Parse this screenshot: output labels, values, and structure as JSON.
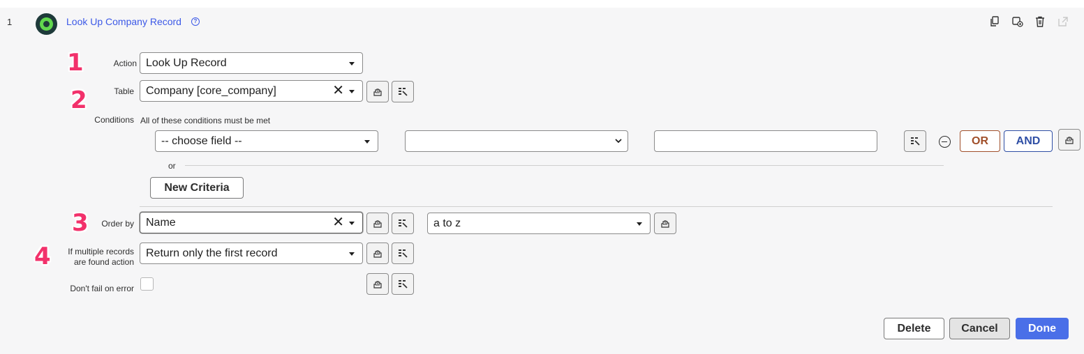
{
  "step": {
    "number": "1",
    "title": "Look Up Company Record",
    "help_icon": "question-circle-icon",
    "toolbar_icons": [
      "copy-icon",
      "data-pill-icon",
      "trash-icon",
      "external-link-icon"
    ]
  },
  "annotations": [
    "1",
    "2",
    "3",
    "4"
  ],
  "form": {
    "action": {
      "label": "Action",
      "value": "Look Up Record"
    },
    "table": {
      "label": "Table",
      "value": "Company [core_company]"
    },
    "conditions": {
      "label": "Conditions",
      "description": "All of these conditions must be met",
      "field_placeholder": "-- choose field --",
      "operator_value": "",
      "value": "",
      "or_label": "OR",
      "and_label": "AND",
      "or_separator": "or",
      "new_criteria_label": "New Criteria"
    },
    "order_by": {
      "label": "Order by",
      "value": "Name",
      "direction": "a to z"
    },
    "multiple_records": {
      "label_line1": "If multiple records",
      "label_line2": "are found action",
      "value": "Return only the first record"
    },
    "dont_fail": {
      "label": "Don't fail on error",
      "checked": false
    }
  },
  "footer": {
    "delete_label": "Delete",
    "cancel_label": "Cancel",
    "done_label": "Done"
  },
  "colors": {
    "accent": "#3c59e7",
    "primary_button": "#4a6fe8",
    "annotation": "#f2316b",
    "or_button": "#a04f2a",
    "and_button": "#2f4fa5"
  }
}
